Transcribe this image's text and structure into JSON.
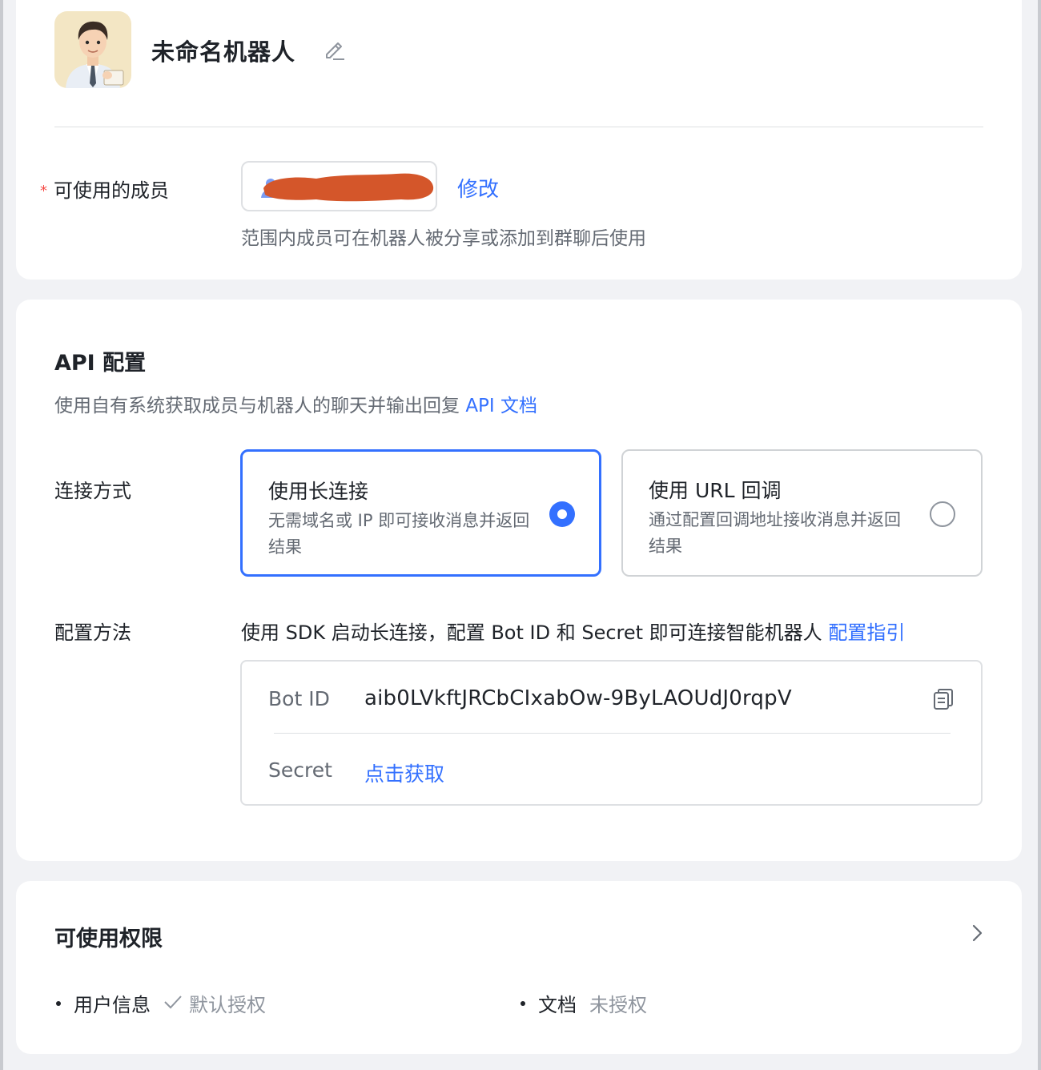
{
  "bot": {
    "name": "未命名机器人"
  },
  "members": {
    "label": "可使用的成员",
    "required_mark": "*",
    "modify_label": "修改",
    "hint": "范围内成员可在机器人被分享或添加到群聊后使用"
  },
  "api": {
    "title": "API 配置",
    "description": "使用自有系统获取成员与机器人的聊天并输出回复",
    "doc_link": "API 文档",
    "connection_label": "连接方式",
    "options": [
      {
        "title": "使用长连接",
        "description": "无需域名或 IP 即可接收消息并返回结果",
        "selected": true
      },
      {
        "title": "使用 URL 回调",
        "description": "通过配置回调地址接收消息并返回结果",
        "selected": false
      }
    ],
    "config_label": "配置方法",
    "config_description": "使用 SDK 启动长连接，配置 Bot ID 和 Secret 即可连接智能机器人",
    "guide_link": "配置指引",
    "credentials": {
      "bot_id_label": "Bot ID",
      "bot_id_value": "aib0LVkftJRCbCIxabOw-9ByLAOUdJ0rqpV",
      "secret_label": "Secret",
      "secret_action": "点击获取"
    }
  },
  "permissions": {
    "title": "可使用权限",
    "items": [
      {
        "name": "用户信息",
        "status": "默认授权",
        "granted": true
      },
      {
        "name": "文档",
        "status": "未授权",
        "granted": false
      }
    ]
  },
  "colors": {
    "accent": "#3370ff",
    "required": "#f54a45",
    "redaction": "#d4562a",
    "background": "#f1f2f5"
  }
}
